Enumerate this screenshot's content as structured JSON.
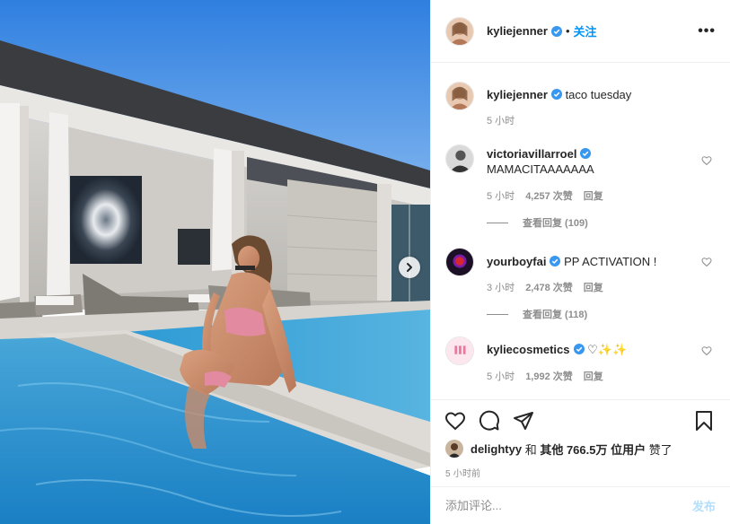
{
  "header": {
    "username": "kyliejenner",
    "separator": "•",
    "follow_label": "关注",
    "more_label": "•••"
  },
  "caption": {
    "username": "kyliejenner",
    "text": "taco tuesday",
    "time": "5 小时"
  },
  "comments": [
    {
      "username": "victoriavillarroel",
      "text": "MAMACITAAAAAAA",
      "time": "5 小时",
      "likes": "4,257 次赞",
      "reply_label": "回复",
      "view_replies": "查看回复 (109)"
    },
    {
      "username": "yourboyfai",
      "text": "PP ACTIVATION !",
      "time": "3 小时",
      "likes": "2,478 次赞",
      "reply_label": "回复",
      "view_replies": "查看回复 (118)"
    },
    {
      "username": "kyliecosmetics",
      "text": "♡✨✨",
      "time": "5 小时",
      "likes": "1,992 次赞",
      "reply_label": "回复"
    }
  ],
  "likes_line": {
    "user": "delightyy",
    "and": "和",
    "others": "其他 766.5万 位用户",
    "liked": "赞了"
  },
  "timestamp": "5 小时前",
  "add_comment": {
    "placeholder": "添加评论...",
    "post_label": "发布"
  },
  "colors": {
    "accent": "#0095f6",
    "verified": "#3897f0",
    "post_disabled": "#b2dffc",
    "muted": "#8e8e8e"
  },
  "icons": [
    "chevron-right-icon",
    "verified-badge-icon",
    "more-icon",
    "heart-icon",
    "comment-icon",
    "share-icon",
    "bookmark-icon"
  ]
}
